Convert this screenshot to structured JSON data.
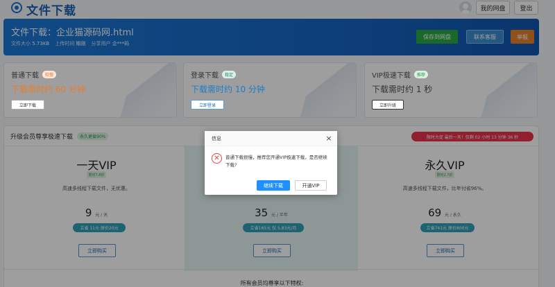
{
  "header": {
    "site_title": "文件下载",
    "my_disk": "我的网盘",
    "logout": "登出"
  },
  "banner": {
    "title": "文件下载：企业猫源码网.html",
    "size_label": "文件大小",
    "size_value": "5.73KB",
    "time_label": "上传时间",
    "time_value": "期刚",
    "share_label": "分享用户",
    "share_value": "企***码",
    "save_btn": "保存到网盘",
    "service_btn": "联系客服",
    "report_btn": "举报"
  },
  "options": [
    {
      "title": "普通下载",
      "tag": "较慢",
      "time": "下载需时约 60 分钟",
      "button": "立即下载"
    },
    {
      "title": "登录下载",
      "tag": "稳定",
      "time": "下载需时约 10 分钟",
      "button": "立即登录"
    },
    {
      "title": "VIP极速下载",
      "tag": "推荐",
      "time": "下载需时约 1 秒",
      "button": "立即升级"
    }
  ],
  "upgrade": {
    "title": "升级会员尊享极速下载",
    "tag": "永久更省90%",
    "promo": "限时大促 最后一天！仅剩 02 小时 13 分钟 36 秒",
    "privilege_text": "所有会员均尊享以下特权:",
    "plans": [
      {
        "name": "一天VIP",
        "tag": "限时7.8折",
        "desc": "高速多线程下载文件，无优惠。",
        "price": "9",
        "unit": "元 / 天",
        "save": "立省 11元 原价20元",
        "buy": "立即购买"
      },
      {
        "name": "",
        "tag": "",
        "desc": "",
        "price": "35",
        "unit": "元 / 半年",
        "save": "立省165元 仅 5.83元/月",
        "buy": "立即购买"
      },
      {
        "name": "永久VIP",
        "tag": "限时2.7折",
        "desc": "高速多线程下载文件，比年付省96%。",
        "price": "69",
        "unit": "元 / 永久",
        "save": "立省741元 原价800元",
        "buy": "立即购买"
      }
    ]
  },
  "modal": {
    "title": "信息",
    "close": "×",
    "icon": "error-icon",
    "message": "普通下载很慢，推荐您开通VIP极速下载，是否继续下载?",
    "continue_btn": "继续下载",
    "vip_btn": "开通VIP"
  }
}
